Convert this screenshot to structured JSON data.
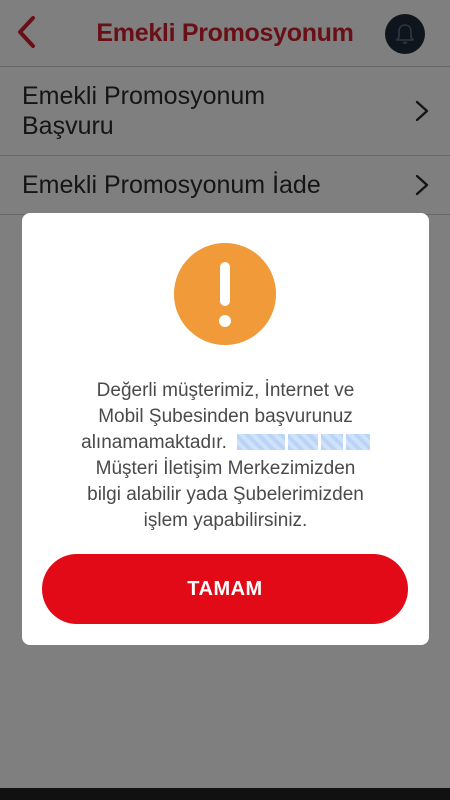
{
  "header": {
    "title": "Emekli Promosyonum",
    "back_icon": "chevron-left-icon",
    "bell_icon": "bell-icon"
  },
  "list": {
    "items": [
      {
        "line1": "Emekli Promosyonum",
        "line2": "Başvuru"
      },
      {
        "line1": "Emekli Promosyonum İade"
      }
    ]
  },
  "dialog": {
    "icon": "warning-icon",
    "message_lines": [
      "Değerli müşterimiz, İnternet ve",
      "Mobil Şubesinden başvurunuz",
      "alınamamaktadır.",
      "Müşteri İletişim Merkezimizden",
      "bilgi alabilir yada Şubelerimizden",
      "işlem yapabilirsiniz."
    ],
    "ok_label": "TAMAM"
  },
  "colors": {
    "brand_red": "#d3202f",
    "button_red": "#e20a16",
    "warning_orange": "#f09a3a",
    "bell_bg": "#1f2a38"
  }
}
